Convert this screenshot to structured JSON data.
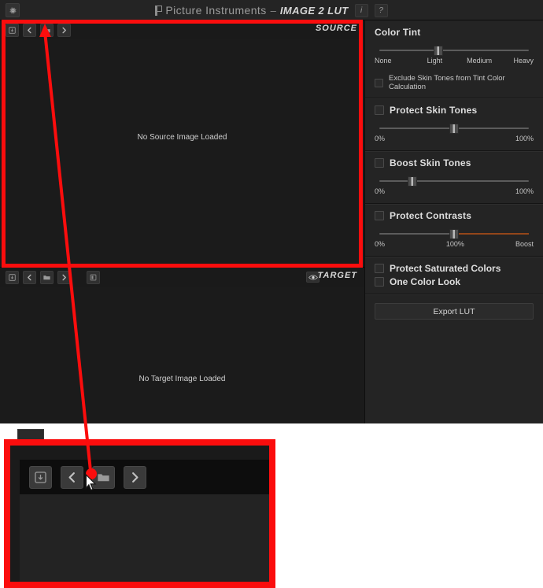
{
  "app": {
    "title_brand": "Picture Instruments",
    "title_separator": "–",
    "title_product": "IMAGE 2 LUT",
    "info_button": "i",
    "help_button": "?",
    "settings_icon": "gear-icon"
  },
  "source_panel": {
    "label": "SOURCE",
    "empty_message": "No Source Image Loaded",
    "toolbar": [
      {
        "name": "load-source-icon",
        "icon": "clipboard-down-icon"
      },
      {
        "name": "previous-source-icon",
        "icon": "chevron-left-icon"
      },
      {
        "name": "open-source-folder-icon",
        "icon": "folder-icon"
      },
      {
        "name": "next-source-icon",
        "icon": "chevron-right-icon"
      }
    ]
  },
  "target_panel": {
    "label": "TARGET",
    "empty_message": "No Target Image Loaded",
    "eye_icon": "eye-toggle-icon",
    "toolbar": [
      {
        "name": "load-target-icon",
        "icon": "clipboard-down-icon"
      },
      {
        "name": "previous-target-icon",
        "icon": "chevron-left-icon"
      },
      {
        "name": "open-target-folder-icon",
        "icon": "folder-icon"
      },
      {
        "name": "next-target-icon",
        "icon": "chevron-right-icon"
      },
      {
        "name": "reset-target-icon",
        "icon": "panel-icon"
      }
    ]
  },
  "sidepanel": {
    "color_tint": {
      "title": "Color Tint",
      "slider_value_pct": 40,
      "scale": [
        "None",
        "Light",
        "Medium",
        "Heavy"
      ],
      "exclude_skin_tones_label": "Exclude Skin Tones from Tint Color Calculation",
      "exclude_skin_tones_checked": false
    },
    "protect_skin_tones": {
      "title": "Protect Skin Tones",
      "checked": false,
      "slider_value_pct": 50,
      "scale_min": "0%",
      "scale_max": "100%"
    },
    "boost_skin_tones": {
      "title": "Boost Skin Tones",
      "checked": false,
      "slider_value_pct": 24,
      "scale_min": "0%",
      "scale_max": "100%"
    },
    "protect_contrasts": {
      "title": "Protect Contrasts",
      "checked": false,
      "slider_value_pct": 50,
      "scale_min": "0%",
      "scale_mid": "100%",
      "scale_max": "Boost",
      "boost_track_color": "#93461a"
    },
    "protect_saturated_colors": {
      "title": "Protect Saturated Colors",
      "checked": false
    },
    "one_color_look": {
      "title": "One Color Look",
      "checked": false
    },
    "export_lut_label": "Export LUT"
  },
  "annotation": {
    "highlight_color": "#fb0d0d",
    "arrow_target": "open-source-folder-button",
    "cursor_icon": "mouse-pointer-icon"
  },
  "inset": {
    "toolbar": [
      {
        "name": "load-source-icon",
        "icon": "clipboard-down-icon"
      },
      {
        "name": "previous-source-icon",
        "icon": "chevron-left-icon"
      },
      {
        "name": "open-source-folder-icon",
        "icon": "folder-icon"
      },
      {
        "name": "next-source-icon",
        "icon": "chevron-right-icon"
      }
    ]
  }
}
